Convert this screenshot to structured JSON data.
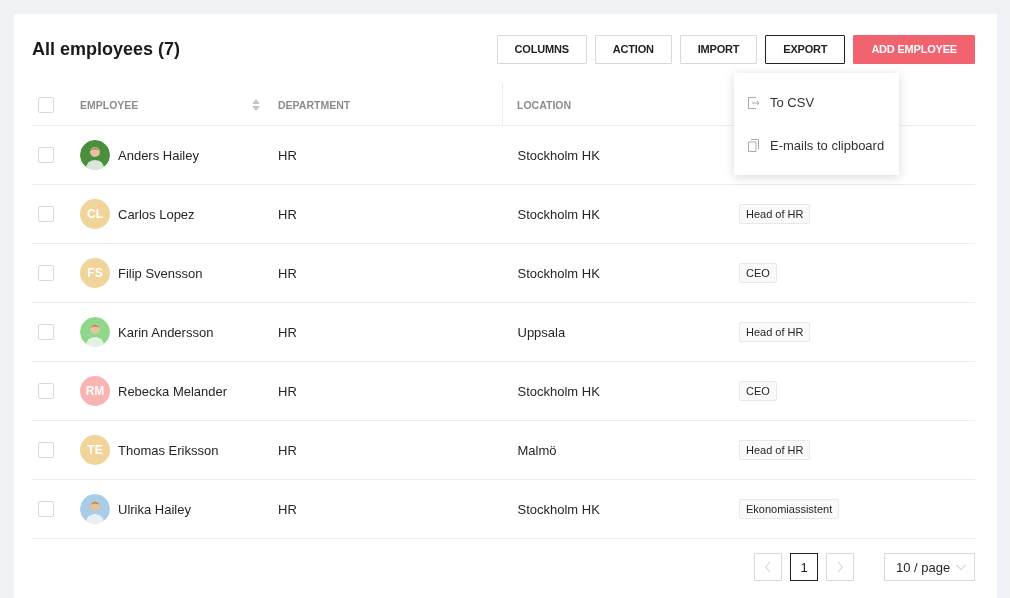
{
  "title": "All employees (7)",
  "toolbar": [
    {
      "label": "COLUMNS",
      "kind": "default",
      "active": false
    },
    {
      "label": "ACTION",
      "kind": "default",
      "active": false
    },
    {
      "label": "IMPORT",
      "kind": "default",
      "active": false
    },
    {
      "label": "EXPORT",
      "kind": "default",
      "active": true
    },
    {
      "label": "ADD EMPLOYEE",
      "kind": "primary",
      "active": false
    }
  ],
  "export_menu": [
    {
      "label": "To CSV"
    },
    {
      "label": "E-mails to clipboard"
    }
  ],
  "table": {
    "header_checkbox": {
      "checked": false
    },
    "columns": [
      {
        "label": "EMPLOYEE",
        "sortable": true
      },
      {
        "label": "DEPARTMENT",
        "sortable": false
      },
      {
        "label": "LOCATION",
        "sortable": false
      }
    ],
    "rows": [
      {
        "checked": false,
        "name": "Anders Hailey",
        "department": "HR",
        "location": "Stockholm HK"
      },
      {
        "checked": false,
        "avatar": {
          "kind": "initials",
          "text": "CL",
          "color": "#f0d49a"
        },
        "name": "Carlos Lopez",
        "department": "HR",
        "location": "Stockholm HK",
        "role": "Head of HR"
      },
      {
        "checked": false,
        "avatar": {
          "kind": "initials",
          "text": "FS",
          "color": "#f0d49a"
        },
        "name": "Filip Svensson",
        "department": "HR",
        "location": "Stockholm HK",
        "role": "CEO"
      },
      {
        "checked": false,
        "name": "Karin Andersson",
        "department": "HR",
        "location": "Uppsala",
        "role": "Head of HR"
      },
      {
        "checked": false,
        "avatar": {
          "kind": "initials",
          "text": "RM",
          "color": "#fab3b3"
        },
        "name": "Rebecka Melander",
        "department": "HR",
        "location": "Stockholm HK",
        "role": "CEO"
      },
      {
        "checked": false,
        "avatar": {
          "kind": "initials",
          "text": "TE",
          "color": "#f0d49a"
        },
        "name": "Thomas Eriksson",
        "department": "HR",
        "location": "Malmö",
        "role": "Head of HR"
      },
      {
        "checked": false,
        "name": "Ulrika Hailey",
        "department": "HR",
        "location": "Stockholm HK",
        "role": "Ekonomiassistent"
      }
    ]
  },
  "pagination": {
    "prev": {
      "disabled": true
    },
    "pages": [
      {
        "label": "1",
        "selected": true
      }
    ],
    "next": {
      "disabled": true
    },
    "page_size": "10 / page"
  }
}
